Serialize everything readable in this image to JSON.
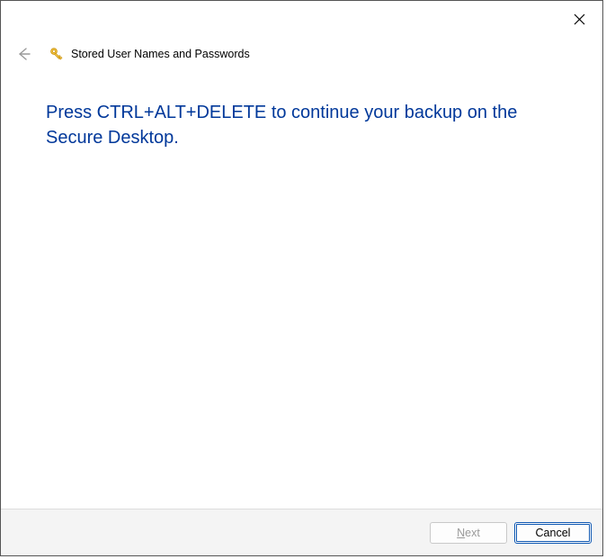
{
  "header": {
    "title": "Stored User Names and Passwords"
  },
  "content": {
    "instruction": "Press CTRL+ALT+DELETE to continue your backup on the Secure Desktop."
  },
  "footer": {
    "next_prefix": "N",
    "next_suffix": "ext",
    "cancel_label": "Cancel"
  }
}
